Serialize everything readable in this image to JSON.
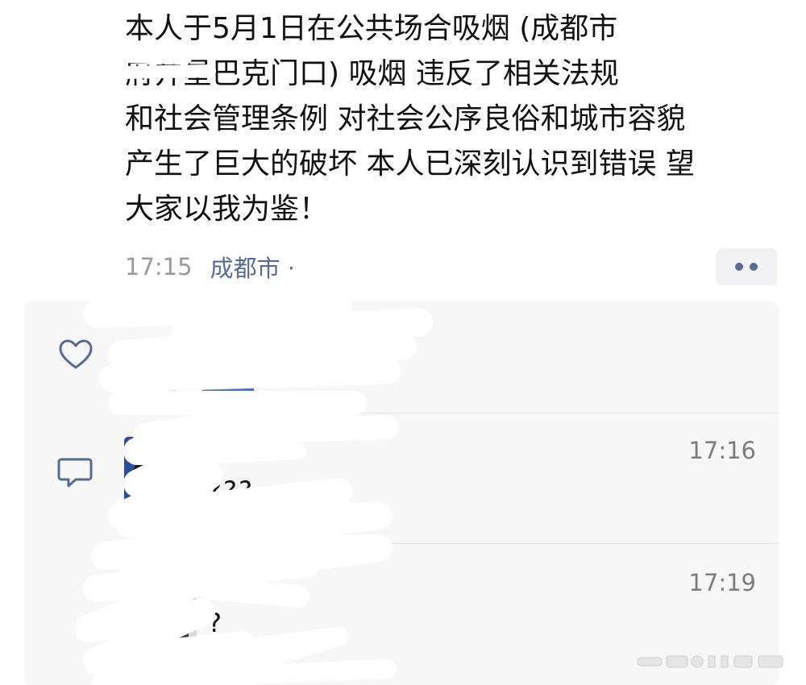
{
  "post": {
    "text": "本人于5月1日在公共场合吸烟 (成都市\n府井星巴克门口) 吸烟 违反了相关法规\n和社会管理条例 对社会公序良俗和城市容貌\n产生了巨大的破坏 本人已深刻认识到错误 望\n大家以我为鉴！",
    "time": "17:15",
    "location": "成都市 ·"
  },
  "icons": {
    "like": "heart-outline-icon",
    "comment": "speech-bubble-icon",
    "more": "two-dots-icon"
  },
  "colors": {
    "link": "#576b95",
    "panel_bg": "#f7f7f7",
    "time_gray": "#9a9a9a"
  },
  "comments": [
    {
      "time": "17:16",
      "text": "???"
    },
    {
      "time": "17:19",
      "text": "?"
    }
  ]
}
